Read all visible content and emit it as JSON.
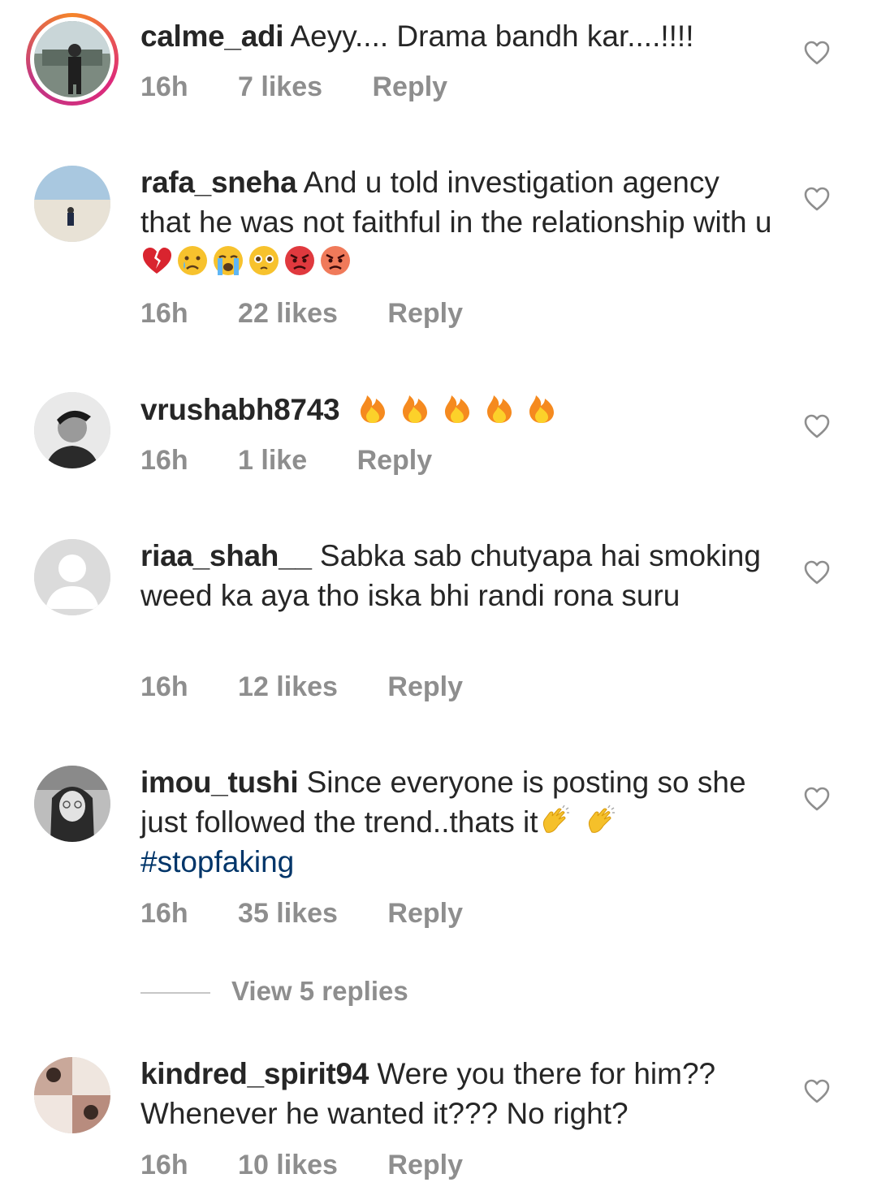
{
  "comments": [
    {
      "username": "calme_adi",
      "text": "Aeyy.... Drama bandh kar....!!!!",
      "time": "16h",
      "likes": "7 likes",
      "reply": "Reply",
      "emojis": [],
      "hashtag": ""
    },
    {
      "username": "rafa_sneha",
      "text": "And u told investigation agency that he was not faithful in the relationship with u",
      "time": "16h",
      "likes": "22 likes",
      "reply": "Reply",
      "emojis": [
        "broken-heart-emoji",
        "crying-face-emoji",
        "loudly-crying-face-emoji",
        "pleading-face-emoji",
        "angry-red-face-emoji",
        "angry-face-emoji"
      ],
      "hashtag": ""
    },
    {
      "username": "vrushabh8743",
      "text": "",
      "time": "16h",
      "likes": "1 like",
      "reply": "Reply",
      "emojis": [
        "fire-emoji",
        "fire-emoji",
        "fire-emoji",
        "fire-emoji",
        "fire-emoji"
      ],
      "hashtag": ""
    },
    {
      "username": "riaa_shah__",
      "text": "Sabka sab chutyapa hai smoking weed ka aya tho iska bhi randi rona suru",
      "time": "16h",
      "likes": "12 likes",
      "reply": "Reply",
      "emojis": [],
      "hashtag": ""
    },
    {
      "username": "imou_tushi",
      "text": "Since everyone is posting so she just followed the trend..thats it",
      "time": "16h",
      "likes": "35 likes",
      "reply": "Reply",
      "emojis": [
        "clapping-hands-emoji",
        "clapping-hands-emoji"
      ],
      "hashtag": "#stopfaking"
    },
    {
      "username": "kindred_spirit94",
      "text": "Were you there for him?? Whenever he wanted it??? No right?",
      "time": "16h",
      "likes": "10 likes",
      "reply": "Reply",
      "emojis": [],
      "hashtag": ""
    }
  ],
  "view_replies": "View 5 replies",
  "colors": {
    "text": "#262626",
    "meta": "#8e8e8e",
    "hashtag": "#003569",
    "story_ring_start": "#f58529",
    "story_ring_end": "#dd2a7b"
  }
}
